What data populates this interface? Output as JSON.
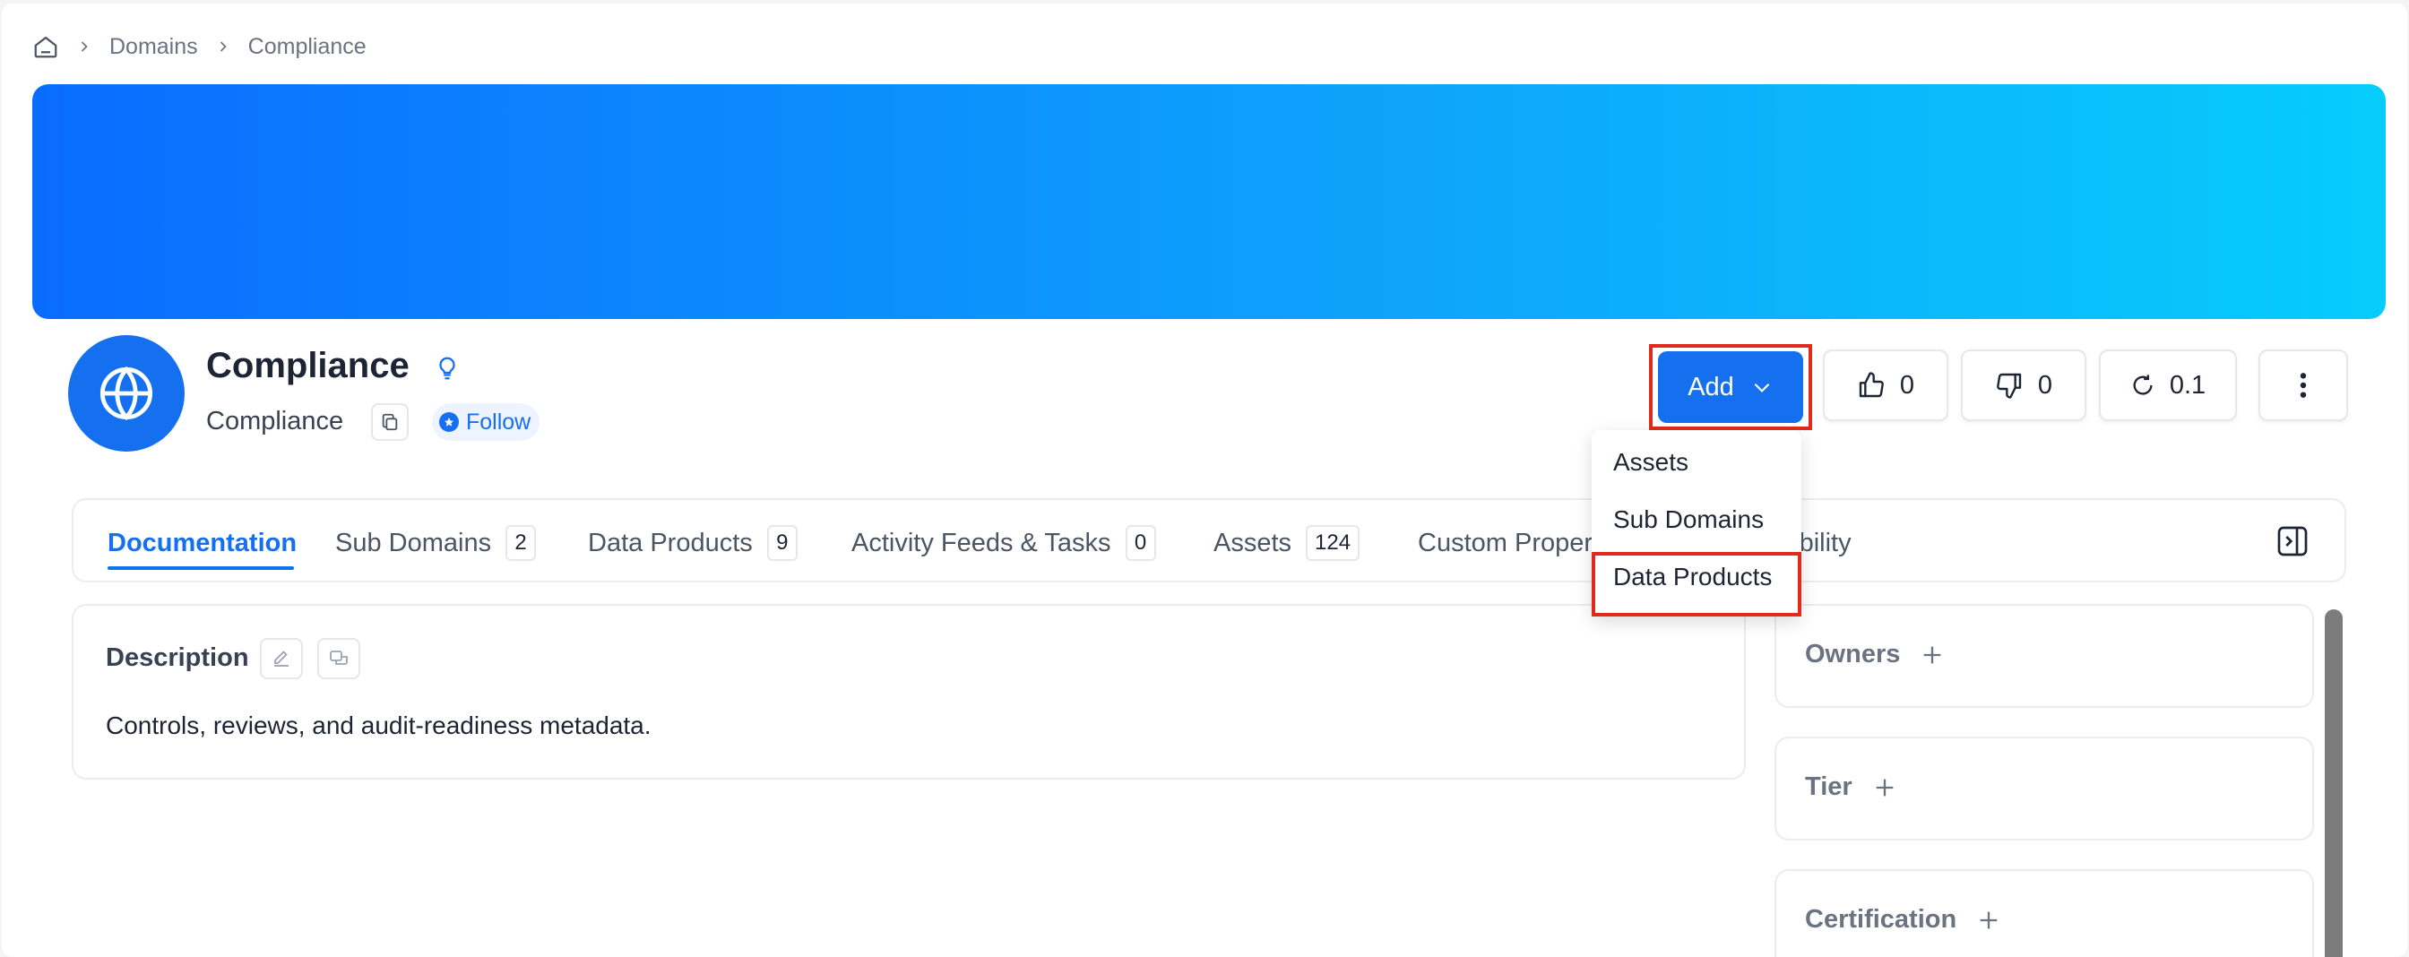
{
  "breadcrumb": {
    "items": [
      "Domains",
      "Compliance"
    ]
  },
  "header": {
    "title": "Compliance",
    "display_name": "Compliance",
    "follow_label": "Follow"
  },
  "actions": {
    "add_label": "Add",
    "likes": "0",
    "dislikes": "0",
    "version": "0.1"
  },
  "add_menu": {
    "items": [
      "Assets",
      "Sub Domains",
      "Data Products"
    ],
    "highlighted": "Data Products"
  },
  "tabs": [
    {
      "label": "Documentation",
      "active": true
    },
    {
      "label": "Sub Domains",
      "count": "2"
    },
    {
      "label": "Data Products",
      "count": "9"
    },
    {
      "label": "Activity Feeds & Tasks",
      "count": "0"
    },
    {
      "label": "Assets",
      "count": "124"
    },
    {
      "label": "Custom Properties"
    },
    {
      "label": "Observability"
    }
  ],
  "description": {
    "title": "Description",
    "text": "Controls, reviews, and audit-readiness metadata."
  },
  "side_panel": {
    "owners": "Owners",
    "tier": "Tier",
    "certification": "Certification"
  },
  "colors": {
    "primary": "#1570ef",
    "highlight": "#e02a1b",
    "banner_start": "#0a6cff",
    "banner_end": "#06ccfb"
  },
  "icons": [
    "home-icon",
    "chevron-right-icon",
    "globe-icon",
    "lightbulb-icon",
    "copy-icon",
    "star-icon",
    "chevron-down-icon",
    "thumbs-up-icon",
    "thumbs-down-icon",
    "history-icon",
    "more-vertical-icon",
    "panel-toggle-icon",
    "edit-icon",
    "comment-icon",
    "plus-icon"
  ]
}
